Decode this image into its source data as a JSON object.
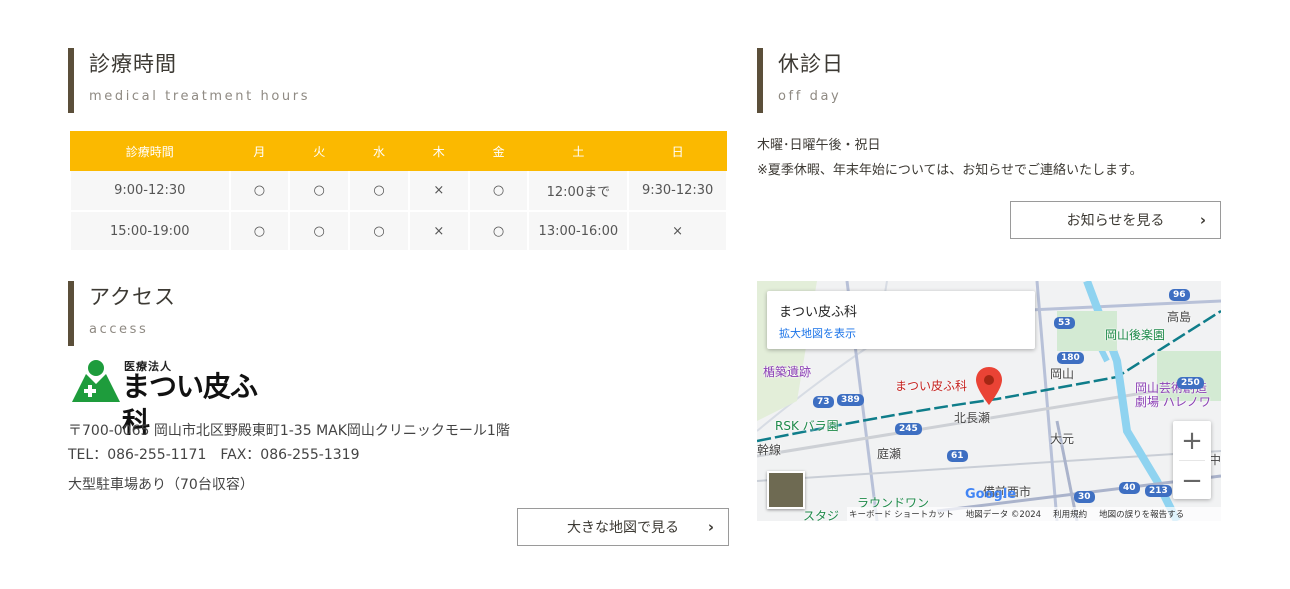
{
  "hours_section": {
    "title_jp": "診療時間",
    "title_en": "medical treatment hours",
    "table": {
      "header": [
        "診療時間",
        "月",
        "火",
        "水",
        "木",
        "金",
        "土",
        "日"
      ],
      "rows": [
        [
          "9:00-12:30",
          "○",
          "○",
          "○",
          "×",
          "○",
          "12:00まで",
          "9:30-12:30"
        ],
        [
          "15:00-19:00",
          "○",
          "○",
          "○",
          "×",
          "○",
          "13:00-16:00",
          "×"
        ]
      ]
    },
    "accent_color": "#fbb900"
  },
  "off_section": {
    "title_jp": "休診日",
    "title_en": "off day",
    "line1": "木曜･日曜午後・祝日",
    "line2": "※夏季休暇、年末年始については、お知らせでご連絡いたします。",
    "button_label": "お知らせを見る",
    "button_icon": "chevron-right-icon"
  },
  "access_section": {
    "title_jp": "アクセス",
    "title_en": "access",
    "logo": {
      "corp_label": "医療法人",
      "name": "まつい皮ふ科",
      "icon": "clinic-logo-icon",
      "color": "#1e9c3c"
    },
    "address": "〒700-0065 岡山市北区野殿東町1-35 MAK岡山クリニックモール1階",
    "tel_fax": "TEL：086-255-1171　FAX：086-255-1319",
    "parking": "大型駐車場あり（70台収容）",
    "button_label": "大きな地図で見る",
    "button_icon": "chevron-right-icon"
  },
  "map": {
    "info_title": "まつい皮ふ科",
    "info_link": "拡大地図を表示",
    "pin_label": "まつい皮ふ科",
    "places": {
      "tatetsuki": "楯築遺跡",
      "rsk": "RSK バラ園",
      "kitanagase": "北長瀬",
      "niwase": "庭瀬",
      "omoto": "大元",
      "okayama": "岡山",
      "korakuen": "岡山後楽園",
      "takashima": "高島",
      "hareno1": "岡山芸術創造",
      "hareno2": "劇場 ハレノワ",
      "bizen": "備前西市",
      "round1": "ラウンドワン",
      "stadium": "スタジ",
      "shinkansen": "幹線",
      "naka": "中"
    },
    "route_shields": [
      "96",
      "53",
      "180",
      "250",
      "73",
      "389",
      "245",
      "61",
      "40",
      "213",
      "30"
    ],
    "zoom_in": "+",
    "zoom_out": "−",
    "google_logo": "Google",
    "footer": {
      "keyboard": "キーボード ショートカット",
      "data": "地図データ ©2024",
      "terms": "利用規約",
      "report": "地図の誤りを報告する"
    }
  }
}
